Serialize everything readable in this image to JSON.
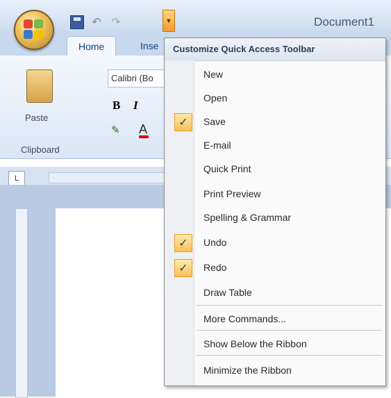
{
  "window": {
    "document_title": "Document1"
  },
  "tabs": [
    {
      "label": "Home"
    },
    {
      "label": "Inse"
    }
  ],
  "ribbon": {
    "paste_label": "Paste",
    "clipboard_label": "Clipboard",
    "font_name": "Calibri (Bo",
    "bold": "B",
    "italic": "I",
    "font_color": "A"
  },
  "ruler": {
    "tab_selector": "L"
  },
  "menu": {
    "header": "Customize Quick Access Toolbar",
    "items": [
      {
        "label": "New",
        "checked": false
      },
      {
        "label": "Open",
        "checked": false
      },
      {
        "label": "Save",
        "checked": true
      },
      {
        "label": "E-mail",
        "checked": false
      },
      {
        "label": "Quick Print",
        "checked": false
      },
      {
        "label": "Print Preview",
        "checked": false
      },
      {
        "label": "Spelling & Grammar",
        "checked": false
      },
      {
        "label": "Undo",
        "checked": true
      },
      {
        "label": "Redo",
        "checked": true
      },
      {
        "label": "Draw Table",
        "checked": false
      },
      {
        "label": "More Commands...",
        "checked": false
      },
      {
        "label": "Show Below the Ribbon",
        "checked": false
      },
      {
        "label": "Minimize the Ribbon",
        "checked": false
      }
    ],
    "check_glyph": "✓"
  },
  "colors": {
    "accent": "#f7c257",
    "ribbon": "#dbe6f5",
    "title_text": "#15428b"
  }
}
